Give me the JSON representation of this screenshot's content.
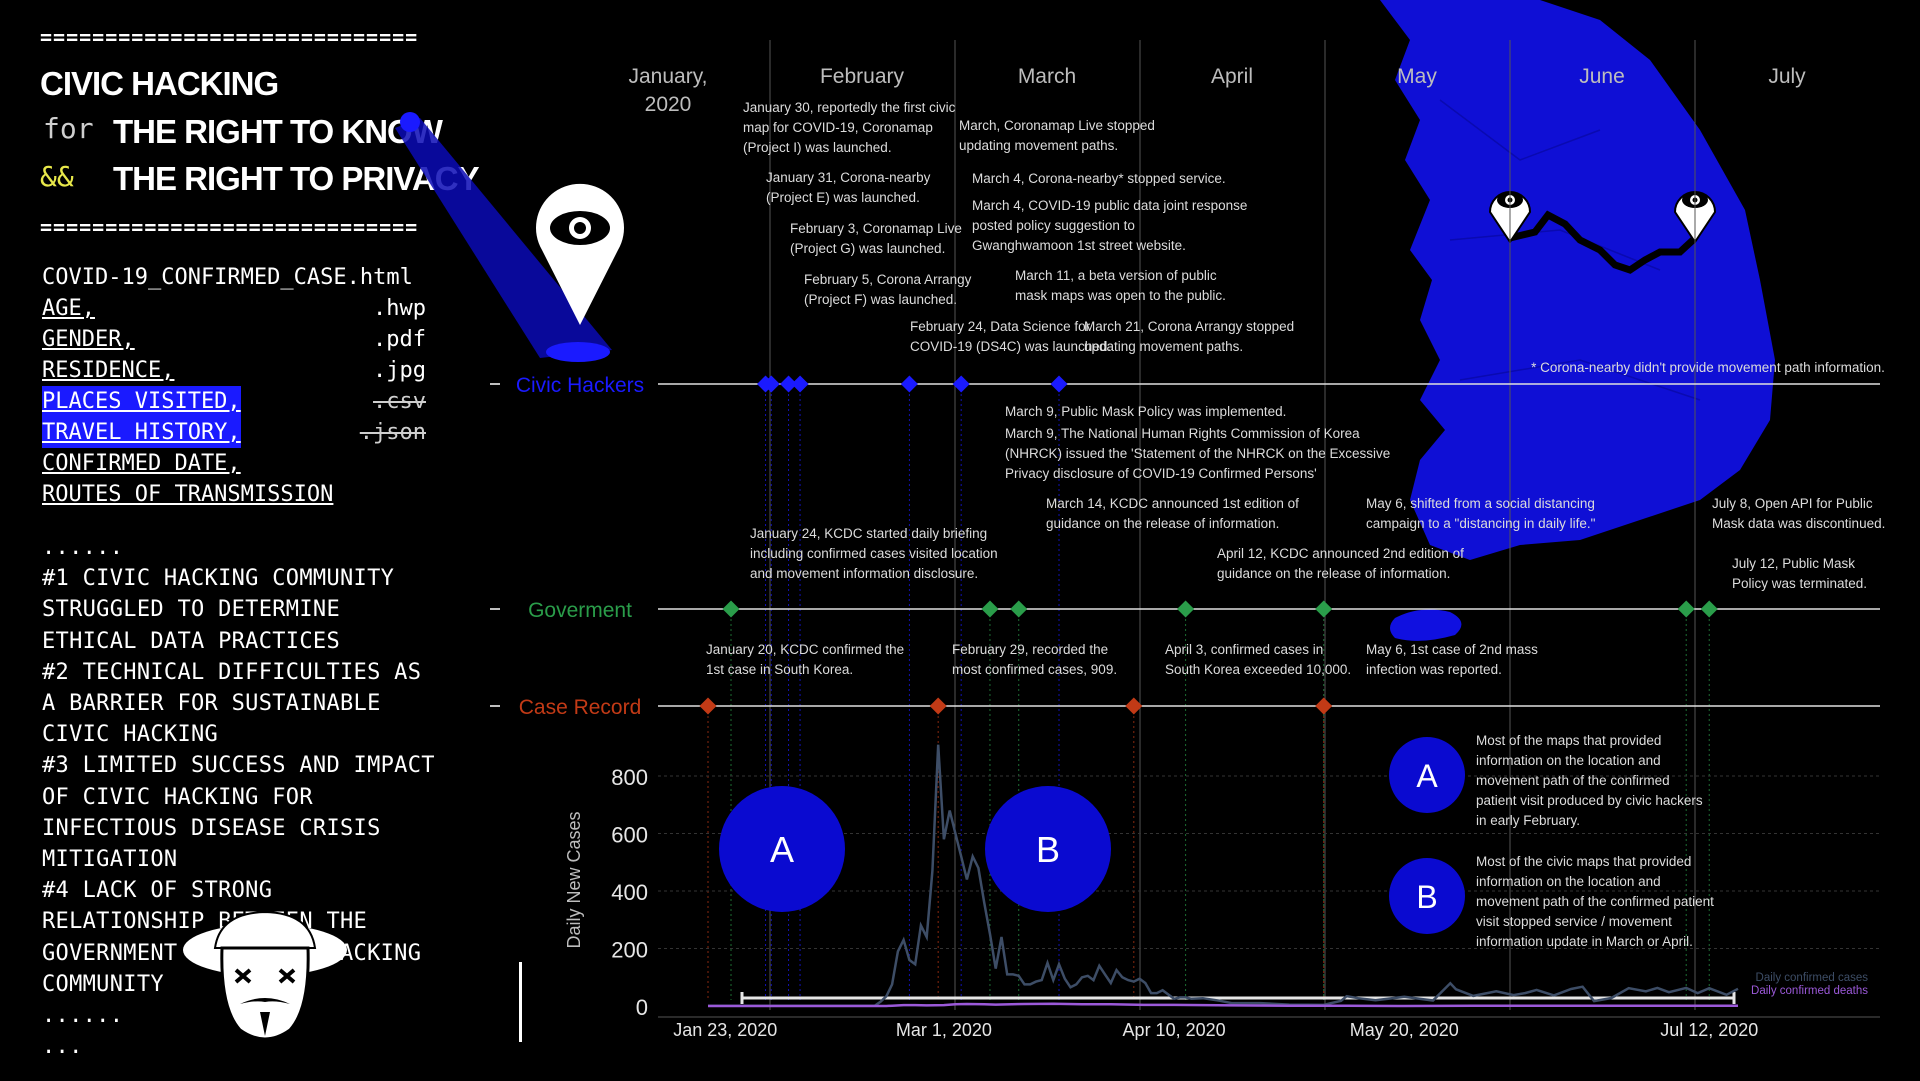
{
  "header": {
    "rule": "=============================",
    "title_line1": "CIVIC HACKING",
    "for_kw": "for",
    "title_line2": "THE RIGHT TO KNOW",
    "and_kw": "&&",
    "title_line3": "THE RIGHT TO PRIVACY"
  },
  "files": [
    {
      "field": "COVID-19_CONFIRMED_CASE.html",
      "ext": "",
      "hl": false,
      "u": false,
      "strike": false
    },
    {
      "field": "AGE,",
      "ext": ".hwp",
      "hl": false,
      "u": true,
      "strike": false
    },
    {
      "field": "GENDER,",
      "ext": ".pdf",
      "hl": false,
      "u": true,
      "strike": false
    },
    {
      "field": "RESIDENCE,",
      "ext": ".jpg",
      "hl": false,
      "u": true,
      "strike": false
    },
    {
      "field": "PLACES VISITED,",
      "ext": ".csv",
      "hl": true,
      "u": true,
      "strike": true
    },
    {
      "field": "TRAVEL HISTORY,",
      "ext": ".json",
      "hl": true,
      "u": true,
      "strike": true
    },
    {
      "field": "CONFIRMED DATE,",
      "ext": "",
      "hl": false,
      "u": true,
      "strike": false
    },
    {
      "field": "ROUTES OF TRANSMISSION",
      "ext": "",
      "hl": false,
      "u": true,
      "strike": false
    }
  ],
  "findings": [
    "......",
    "#1 CIVIC HACKING COMMUNITY",
    "STRUGGLED TO DETERMINE",
    "ETHICAL DATA PRACTICES",
    "#2 TECHNICAL DIFFICULTIES AS",
    "A BARRIER FOR SUSTAINABLE",
    "CIVIC HACKING",
    "#3 LIMITED SUCCESS AND IMPACT",
    "OF CIVIC HACKING FOR",
    "INFECTIOUS DISEASE CRISIS",
    "MITIGATION",
    "#4 LACK OF STRONG",
    "RELATIONSHIP BETWEEN THE",
    "GOVERNMENT AND CIVIC HACKING",
    "COMMUNITY",
    "......",
    "..."
  ],
  "colors": {
    "civic": "#1a1aff",
    "government": "#2a9d4a",
    "case": "#c23a16",
    "confirmed_line": "#3d4d66",
    "deaths_line": "#9b59d9",
    "map": "#1010e0",
    "badge": "#0a0ad0"
  },
  "timeline": {
    "months": [
      "January, 2020",
      "February",
      "March",
      "April",
      "May",
      "June",
      "July"
    ],
    "tracks": {
      "civic": {
        "label": "Civic Hackers",
        "dates": [
          "2020-01-30",
          "2020-01-31",
          "2020-02-03",
          "2020-02-05",
          "2020-02-24",
          "2020-03-04",
          "2020-03-21"
        ]
      },
      "government": {
        "label": "Goverment",
        "dates": [
          "2020-01-24",
          "2020-03-09",
          "2020-03-14",
          "2020-04-12",
          "2020-05-06",
          "2020-07-08",
          "2020-07-12"
        ]
      },
      "case": {
        "label": "Case Record",
        "dates": [
          "2020-01-20",
          "2020-02-29",
          "2020-04-03",
          "2020-05-06"
        ]
      }
    },
    "annotations": [
      {
        "lines": [
          "January 30, reportedly the first civic",
          "map for COVID-19, Coronamap",
          "(Project I) was launched."
        ]
      },
      {
        "lines": [
          "January 31, Corona-nearby",
          "(Project E) was launched."
        ]
      },
      {
        "lines": [
          "February 3, Coronamap Live",
          "(Project G) was launched."
        ]
      },
      {
        "lines": [
          "February 5, Corona Arrangy",
          "(Project F) was launched."
        ]
      },
      {
        "lines": [
          "February 24, Data Science for",
          "COVID-19 (DS4C) was launched."
        ]
      },
      {
        "lines": [
          "March, Coronamap Live stopped",
          "updating movement paths."
        ]
      },
      {
        "lines": [
          "March 4, Corona-nearby* stopped service."
        ]
      },
      {
        "lines": [
          "March 4, COVID-19 public data joint response",
          "posted policy suggestion to",
          "Gwanghwamoon 1st street website."
        ]
      },
      {
        "lines": [
          "March 11, a beta version of public",
          "mask maps was open to the public."
        ]
      },
      {
        "lines": [
          "March 21, Corona Arrangy stopped",
          "updating movement paths."
        ]
      },
      {
        "lines": [
          "* Corona-nearby didn't provide movement path information."
        ]
      },
      {
        "lines": [
          "March 9, Public Mask Policy was implemented."
        ]
      },
      {
        "lines": [
          "March 9, The National Human Rights Commission of Korea",
          "(NHRCK) issued the 'Statement of the NHRCK on the Excessive",
          "Privacy disclosure of COVID-19 Confirmed Persons'"
        ]
      },
      {
        "lines": [
          "March 14, KCDC announced 1st edition of",
          "guidance on the release of information."
        ]
      },
      {
        "lines": [
          "May 6, shifted from a social distancing",
          "campaign to a \"distancing in daily life.\""
        ]
      },
      {
        "lines": [
          "July 8, Open API for Public",
          "Mask data was discontinued."
        ]
      },
      {
        "lines": [
          "January 24, KCDC started daily briefing",
          "including confirmed cases visited location",
          "and movement information disclosure."
        ]
      },
      {
        "lines": [
          "April 12, KCDC announced 2nd edition of",
          "guidance on the release of information."
        ]
      },
      {
        "lines": [
          "July 12, Public Mask",
          "Policy was terminated."
        ]
      },
      {
        "lines": [
          "January 20, KCDC confirmed the",
          "1st case in South Korea."
        ]
      },
      {
        "lines": [
          "February 29, recorded the",
          "most confirmed cases, 909."
        ]
      },
      {
        "lines": [
          "April 3, confirmed cases in",
          "South Korea exceeded 10,000."
        ]
      },
      {
        "lines": [
          "May 6, 1st case of 2nd mass",
          "infection was reported."
        ]
      }
    ]
  },
  "legend_notes": [
    {
      "badge": "A",
      "lines": [
        "Most of the maps that provided",
        "information on the location and",
        "movement path of the confirmed",
        "patient visit produced by civic hackers",
        "in early February."
      ]
    },
    {
      "badge": "B",
      "lines": [
        "Most of the civic maps that provided",
        "information on the location and",
        "movement path of the confirmed patient",
        "visit stopped service / movement",
        "information update in March or April."
      ]
    }
  ],
  "chart_data": {
    "type": "line",
    "title": "",
    "xlabel": "",
    "ylabel": "Daily New Cases",
    "ylim": [
      0,
      850
    ],
    "yticks": [
      "800",
      "600",
      "400",
      "200",
      "0"
    ],
    "xtick_labels": [
      "Jan 23, 2020",
      "Mar 1, 2020",
      "Apr 10, 2020",
      "May 20, 2020",
      "Jul 12, 2020"
    ],
    "xtick_dates": [
      "2020-01-23",
      "2020-03-01",
      "2020-04-10",
      "2020-05-20",
      "2020-07-12"
    ],
    "x_range": [
      "2020-01-20",
      "2020-07-17"
    ],
    "grid": true,
    "legend_position": "bottom-right",
    "series": [
      {
        "name": "Daily confirmed cases",
        "points": [
          [
            "2020-01-20",
            1
          ],
          [
            "2020-02-01",
            1
          ],
          [
            "2020-02-10",
            1
          ],
          [
            "2020-02-17",
            1
          ],
          [
            "2020-02-18",
            1
          ],
          [
            "2020-02-19",
            15
          ],
          [
            "2020-02-20",
            34
          ],
          [
            "2020-02-21",
            75
          ],
          [
            "2020-02-22",
            190
          ],
          [
            "2020-02-23",
            230
          ],
          [
            "2020-02-24",
            160
          ],
          [
            "2020-02-25",
            145
          ],
          [
            "2020-02-26",
            280
          ],
          [
            "2020-02-27",
            240
          ],
          [
            "2020-02-28",
            470
          ],
          [
            "2020-02-29",
            909
          ],
          [
            "2020-03-01",
            580
          ],
          [
            "2020-03-02",
            680
          ],
          [
            "2020-03-03",
            600
          ],
          [
            "2020-03-04",
            520
          ],
          [
            "2020-03-05",
            440
          ],
          [
            "2020-03-06",
            520
          ],
          [
            "2020-03-07",
            480
          ],
          [
            "2020-03-08",
            360
          ],
          [
            "2020-03-09",
            250
          ],
          [
            "2020-03-10",
            130
          ],
          [
            "2020-03-11",
            240
          ],
          [
            "2020-03-12",
            110
          ],
          [
            "2020-03-13",
            110
          ],
          [
            "2020-03-14",
            105
          ],
          [
            "2020-03-15",
            75
          ],
          [
            "2020-03-16",
            75
          ],
          [
            "2020-03-17",
            85
          ],
          [
            "2020-03-18",
            90
          ],
          [
            "2020-03-19",
            150
          ],
          [
            "2020-03-20",
            90
          ],
          [
            "2020-03-21",
            145
          ],
          [
            "2020-03-22",
            95
          ],
          [
            "2020-03-23",
            65
          ],
          [
            "2020-03-24",
            75
          ],
          [
            "2020-03-25",
            100
          ],
          [
            "2020-03-26",
            105
          ],
          [
            "2020-03-27",
            90
          ],
          [
            "2020-03-28",
            140
          ],
          [
            "2020-03-29",
            110
          ],
          [
            "2020-03-30",
            80
          ],
          [
            "2020-03-31",
            125
          ],
          [
            "2020-04-01",
            100
          ],
          [
            "2020-04-02",
            90
          ],
          [
            "2020-04-03",
            85
          ],
          [
            "2020-04-04",
            95
          ],
          [
            "2020-04-05",
            80
          ],
          [
            "2020-04-06",
            45
          ],
          [
            "2020-04-07",
            45
          ],
          [
            "2020-04-08",
            55
          ],
          [
            "2020-04-09",
            40
          ],
          [
            "2020-04-10",
            25
          ],
          [
            "2020-04-11",
            30
          ],
          [
            "2020-04-12",
            30
          ],
          [
            "2020-04-13",
            25
          ],
          [
            "2020-04-15",
            27
          ],
          [
            "2020-04-18",
            18
          ],
          [
            "2020-04-20",
            10
          ],
          [
            "2020-04-25",
            10
          ],
          [
            "2020-04-30",
            5
          ],
          [
            "2020-05-06",
            4
          ],
          [
            "2020-05-09",
            18
          ],
          [
            "2020-05-10",
            34
          ],
          [
            "2020-05-12",
            27
          ],
          [
            "2020-05-15",
            20
          ],
          [
            "2020-05-20",
            32
          ],
          [
            "2020-05-25",
            19
          ],
          [
            "2020-05-28",
            79
          ],
          [
            "2020-05-29",
            58
          ],
          [
            "2020-06-01",
            35
          ],
          [
            "2020-06-05",
            51
          ],
          [
            "2020-06-08",
            38
          ],
          [
            "2020-06-10",
            45
          ],
          [
            "2020-06-12",
            56
          ],
          [
            "2020-06-15",
            37
          ],
          [
            "2020-06-18",
            59
          ],
          [
            "2020-06-20",
            67
          ],
          [
            "2020-06-22",
            17
          ],
          [
            "2020-06-25",
            28
          ],
          [
            "2020-06-28",
            62
          ],
          [
            "2020-07-01",
            51
          ],
          [
            "2020-07-03",
            63
          ],
          [
            "2020-07-05",
            48
          ],
          [
            "2020-07-08",
            63
          ],
          [
            "2020-07-10",
            45
          ],
          [
            "2020-07-12",
            62
          ],
          [
            "2020-07-15",
            39
          ],
          [
            "2020-07-17",
            60
          ]
        ]
      },
      {
        "name": "Daily confirmed deaths",
        "points": [
          [
            "2020-01-20",
            0
          ],
          [
            "2020-02-20",
            0
          ],
          [
            "2020-02-21",
            1
          ],
          [
            "2020-02-23",
            3
          ],
          [
            "2020-02-25",
            3
          ],
          [
            "2020-02-27",
            2
          ],
          [
            "2020-03-01",
            3
          ],
          [
            "2020-03-03",
            6
          ],
          [
            "2020-03-05",
            7
          ],
          [
            "2020-03-08",
            6
          ],
          [
            "2020-03-10",
            5
          ],
          [
            "2020-03-15",
            7
          ],
          [
            "2020-03-20",
            8
          ],
          [
            "2020-03-25",
            6
          ],
          [
            "2020-03-30",
            6
          ],
          [
            "2020-04-05",
            4
          ],
          [
            "2020-04-10",
            4
          ],
          [
            "2020-04-15",
            3
          ],
          [
            "2020-04-20",
            2
          ],
          [
            "2020-04-30",
            1
          ],
          [
            "2020-05-10",
            1
          ],
          [
            "2020-05-20",
            0
          ],
          [
            "2020-06-01",
            1
          ],
          [
            "2020-06-15",
            1
          ],
          [
            "2020-07-01",
            1
          ],
          [
            "2020-07-17",
            1
          ]
        ]
      }
    ],
    "markers": [
      "A",
      "B"
    ]
  }
}
